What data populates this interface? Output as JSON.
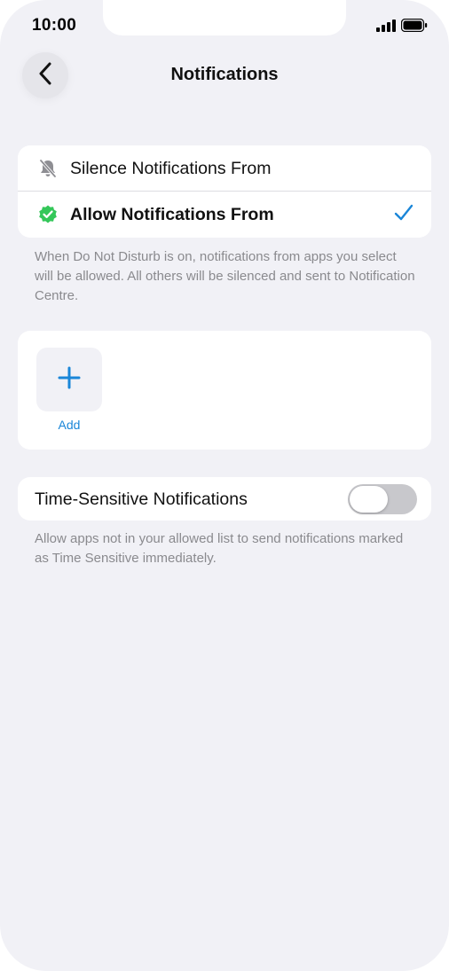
{
  "status_bar": {
    "time": "10:00",
    "icons": [
      "cellular-signal-icon",
      "battery-icon"
    ]
  },
  "header": {
    "title": "Notifications",
    "back_icon": "chevron-left-icon"
  },
  "notification_mode": {
    "options": [
      {
        "label": "Silence Notifications From",
        "icon": "bell-slash-icon",
        "selected": false
      },
      {
        "label": "Allow Notifications From",
        "icon": "verified-badge-icon",
        "selected": true
      }
    ],
    "footnote": "When Do Not Disturb is on, notifications from apps you select will be allowed. All others will be silenced and sent to Notification Centre."
  },
  "apps": {
    "add_label": "Add"
  },
  "time_sensitive": {
    "label": "Time-Sensitive Notifications",
    "enabled": false,
    "footnote": "Allow apps not in your allowed list to send notifications marked as Time Sensitive immediately."
  },
  "colors": {
    "background": "#f1f1f6",
    "accent": "#1a86d8",
    "badge_green": "#34c759",
    "footnote_text": "#8a8a8e",
    "toggle_off": "#c8c8cc"
  }
}
